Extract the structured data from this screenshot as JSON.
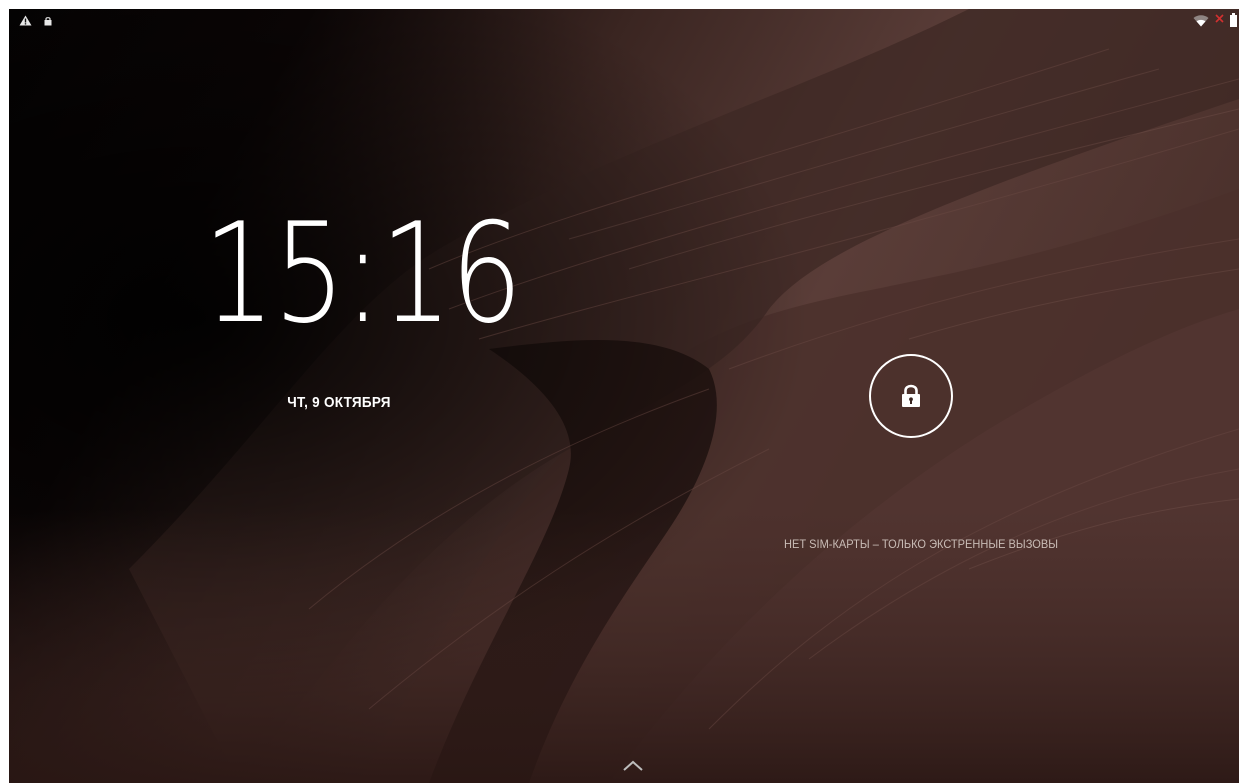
{
  "lockscreen": {
    "time": "15:16",
    "date": "ЧТ, 9 ОКТЯБРЯ",
    "carrier_text": "НЕТ SIM-КАРТЫ – ТОЛЬКО ЭКСТРЕННЫЕ ВЫЗОВЫ"
  },
  "status_bar": {
    "left_icons": [
      "warning-icon",
      "lock-icon"
    ],
    "right_icons": [
      "wifi-icon",
      "no-sim-icon",
      "battery-icon"
    ]
  },
  "icons": {
    "unlock_handle": "lock-icon",
    "swipe_hint": "chevron-up-icon"
  },
  "colors": {
    "text": "#ffffff",
    "carrier_text": "#c9bcb6",
    "no_sim_mark": "#d13030"
  }
}
